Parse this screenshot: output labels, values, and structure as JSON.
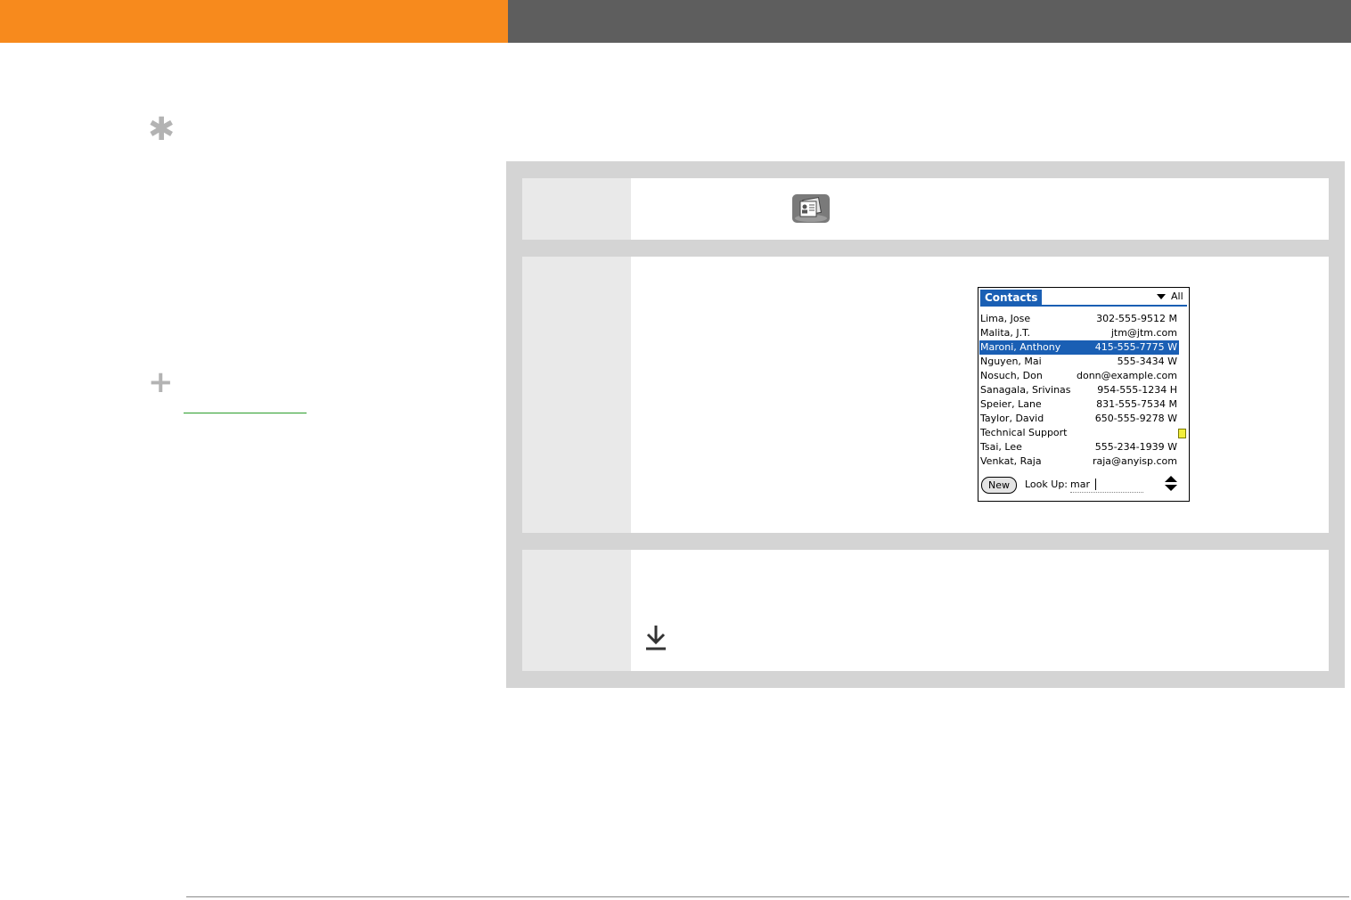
{
  "header": {
    "accent_color": "#f78a1d",
    "bar_color": "#5e5e5e"
  },
  "sidebar": {
    "tip_icon": "asterisk-icon",
    "more_icon": "plus-icon"
  },
  "steps": {
    "step1_icon": "contacts-app-icon",
    "step3_icon": "download-arrow-icon"
  },
  "contacts_screen": {
    "title": "Contacts",
    "category": "All",
    "rows": [
      {
        "name": "Lima, Jose",
        "value": "302-555-9512 M"
      },
      {
        "name": "Malita, J.T.",
        "value": "jtm@jtm.com"
      },
      {
        "name": "Maroni, Anthony",
        "value": "415-555-7775 W"
      },
      {
        "name": "Nguyen, Mai",
        "value": "555-3434 W"
      },
      {
        "name": "Nosuch, Don",
        "value": "donn@example.com"
      },
      {
        "name": "Sanagala, Srivinas",
        "value": "954-555-1234 H"
      },
      {
        "name": "Speier, Lane",
        "value": "831-555-7534 M"
      },
      {
        "name": "Taylor, David",
        "value": "650-555-9278 W"
      },
      {
        "name": "Technical Support",
        "value": ""
      },
      {
        "name": "Tsai, Lee",
        "value": "555-234-1939 W"
      },
      {
        "name": "Venkat, Raja",
        "value": "raja@anyisp.com"
      }
    ],
    "selected_index": 2,
    "new_button": "New",
    "lookup_label": "Look Up:",
    "lookup_value": "mar",
    "highlight_color": "#1a5fb4"
  }
}
